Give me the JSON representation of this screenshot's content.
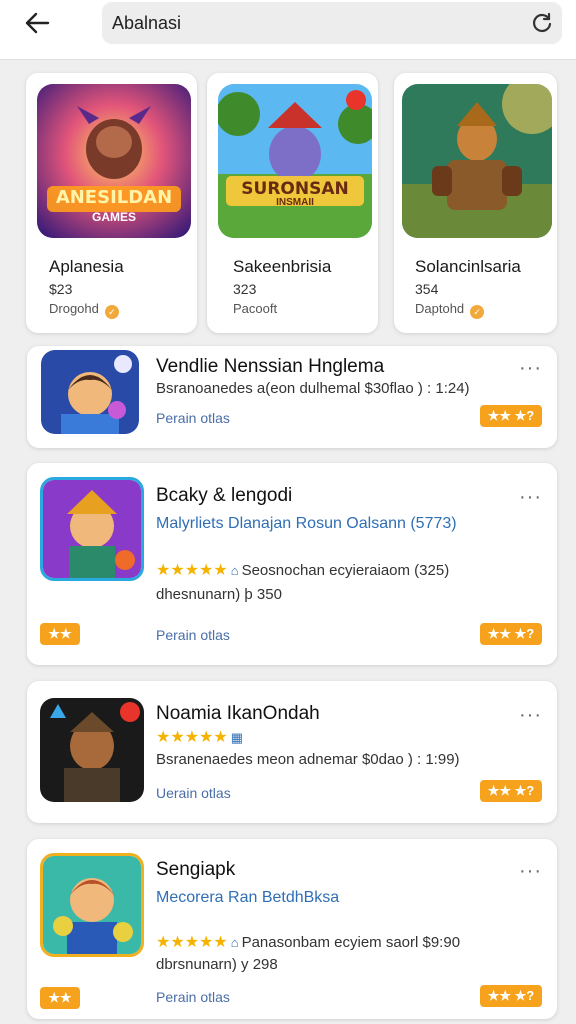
{
  "header": {
    "search_value": "Abalnasi"
  },
  "featured": [
    {
      "name": "Aplanesia",
      "price": "$23",
      "developer": "Drogohd",
      "art_text": "ANESILDAN",
      "art_sub": "GAMES"
    },
    {
      "name": "Sakeenbrisia",
      "price": "323",
      "developer": "Pacooft",
      "art_text": "SURONSAN",
      "art_sub": "INSMAII"
    },
    {
      "name": "Solancinlsaria",
      "price": "354",
      "developer": "Daptohd"
    }
  ],
  "list": [
    {
      "title": "Vendlie Nenssian Hnglema",
      "meta": "Bsranoanedes a(eon dulhemal $30flao ) : 1:24)",
      "link": "Perain otlas",
      "badge": "★★ ★?"
    },
    {
      "title": "Bcaky & lengodi",
      "subtitle": "Malyrliets Dlanajan Rosun Oalsann (5773)",
      "meta": "Seosnochan ecyieraiaom (325)",
      "line2": "dhesnunarn) þ 350",
      "link": "Perain otlas",
      "left_badge": "★★",
      "badge": "★★ ★?"
    },
    {
      "title": "Noamia IkanOndah",
      "meta": "Bsranenaedes meon adnemar $0dao ) : 1:99)",
      "link": "Uerain otlas",
      "badge": "★★ ★?"
    },
    {
      "title": "Sengiapk",
      "subtitle": "Mecorera Ran BetdhBksa",
      "meta": "Panasonbam ecyiem saorl $9:90",
      "line2": "dbrsnunarn) y 298",
      "link": "Perain otlas",
      "left_badge": "★★",
      "badge": "★★ ★?"
    }
  ]
}
